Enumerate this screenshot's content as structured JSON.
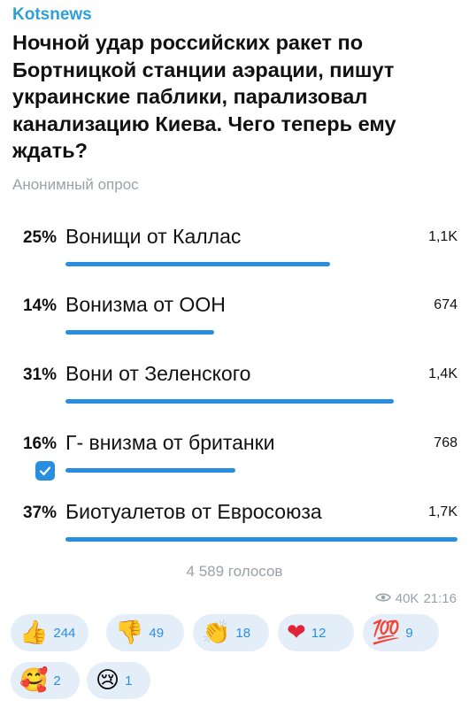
{
  "channel": "Kotsnews",
  "question": "Ночной удар российских ракет по Бортницкой станции аэрации, пишут украинские паблики,  парализовал канализацию Киева. Чего теперь ему ждать?",
  "poll_type": "Анонимный опрос",
  "options": [
    {
      "percent": "25%",
      "label": "Вонищи от Каллас",
      "count": "1,1K",
      "share": 0.25,
      "chosen": false
    },
    {
      "percent": "14%",
      "label": "Вонизма от ООН",
      "count": "674",
      "share": 0.14,
      "chosen": false
    },
    {
      "percent": "31%",
      "label": "Вони от Зеленского",
      "count": "1,4K",
      "share": 0.31,
      "chosen": false
    },
    {
      "percent": "16%",
      "label": "Г- внизма от британки",
      "count": "768",
      "share": 0.16,
      "chosen": true
    },
    {
      "percent": "37%",
      "label": "Биотуалетов от Евросоюза",
      "count": "1,7K",
      "share": 0.37,
      "chosen": false
    }
  ],
  "total_votes": "4 589 голосов",
  "views": "40K",
  "time": "21:16",
  "reactions": [
    {
      "emoji": "👍",
      "icon": "thumbs-up-icon",
      "count": "244"
    },
    {
      "emoji": "👎",
      "icon": "thumbs-down-icon",
      "count": "49"
    },
    {
      "emoji": "👏",
      "icon": "clapping-icon",
      "count": "18"
    },
    {
      "emoji": "❤",
      "icon": "heart-icon",
      "count": "12"
    },
    {
      "emoji": "💯",
      "icon": "hundred-icon",
      "count": "9"
    },
    {
      "emoji": "🥰",
      "icon": "smiling-hearts-icon",
      "count": "2"
    },
    {
      "emoji": "😢",
      "icon": "crying-face-icon",
      "count": "1"
    }
  ],
  "colors": {
    "accent": "#2a8ee0",
    "channel": "#2f9fd6",
    "muted": "#9aa1a7",
    "reaction_bg": "#e4eef8"
  }
}
